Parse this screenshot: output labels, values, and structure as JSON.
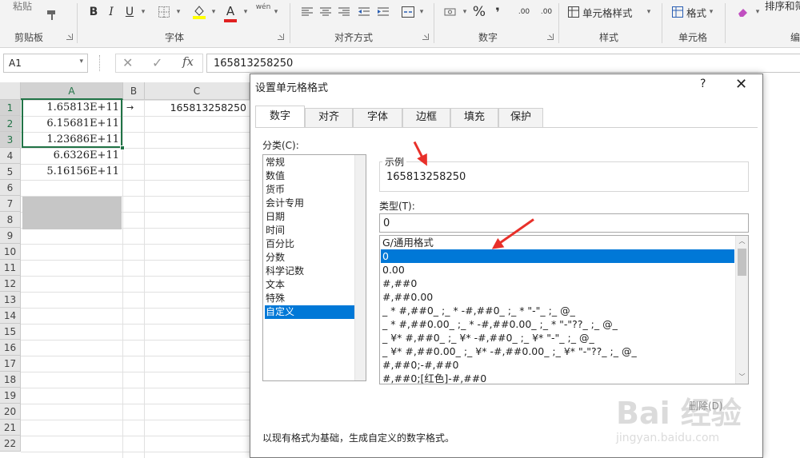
{
  "ribbon": {
    "paste_label": "粘贴",
    "groups": [
      {
        "label": "剪贴板"
      },
      {
        "label": "字体"
      },
      {
        "label": "对齐方式"
      },
      {
        "label": "数字"
      },
      {
        "label": "样式"
      },
      {
        "label": "单元格"
      },
      {
        "label": "编"
      }
    ],
    "bold": "B",
    "italic": "I",
    "underline": "U",
    "phonetic": "wén",
    "percent": "%",
    "comma": "❜",
    "inc_decimal": ".00",
    "dec_decimal": ".00",
    "cell_styles": "单元格样式",
    "format": "格式",
    "sort_filter": "排序和筛",
    "font_color": "A"
  },
  "formula_bar": {
    "name_box": "A1",
    "fx": "fx",
    "value": "165813258250"
  },
  "sheet": {
    "columns": [
      "A",
      "B",
      "C"
    ],
    "rows": [
      "1",
      "2",
      "3",
      "4",
      "5",
      "6",
      "7",
      "8",
      "9",
      "10",
      "11",
      "12",
      "13",
      "14",
      "15",
      "16",
      "17",
      "18",
      "19",
      "20",
      "21",
      "22"
    ],
    "col_a": [
      "1.65813E+11",
      "6.15681E+11",
      "1.23686E+11",
      "6.6326E+11",
      "5.16156E+11"
    ],
    "c1": "165813258250"
  },
  "dialog": {
    "title": "设置单元格格式",
    "help": "?",
    "tabs": [
      "数字",
      "对齐",
      "字体",
      "边框",
      "填充",
      "保护"
    ],
    "active_tab": "数字",
    "category_label": "分类(C):",
    "categories": [
      "常规",
      "数值",
      "货币",
      "会计专用",
      "日期",
      "时间",
      "百分比",
      "分数",
      "科学记数",
      "文本",
      "特殊",
      "自定义"
    ],
    "selected_category": "自定义",
    "sample_label": "示例",
    "sample_value": "165813258250",
    "type_label": "类型(T):",
    "type_value": "0",
    "type_list": [
      "G/通用格式",
      "0",
      "0.00",
      "#,##0",
      "#,##0.00",
      "_ * #,##0_ ;_ * -#,##0_ ;_ * \"-\"_ ;_ @_",
      "_ * #,##0.00_ ;_ * -#,##0.00_ ;_ * \"-\"??_ ;_ @_",
      "_ ¥* #,##0_ ;_ ¥* -#,##0_ ;_ ¥* \"-\"_ ;_ @_",
      "_ ¥* #,##0.00_ ;_ ¥* -#,##0.00_ ;_ ¥* \"-\"??_ ;_ @_",
      "#,##0;-#,##0",
      "#,##0;[红色]-#,##0"
    ],
    "selected_type": "0",
    "delete_label": "删除(D)",
    "description": "以现有格式为基础，生成自定义的数字格式。"
  },
  "watermark": {
    "main": "Bai 经验",
    "sub": "jingyan.baidu.com"
  },
  "colors": {
    "accent_green": "#217346",
    "selection_blue": "#0078d7",
    "annotation_red": "#e8302a"
  }
}
